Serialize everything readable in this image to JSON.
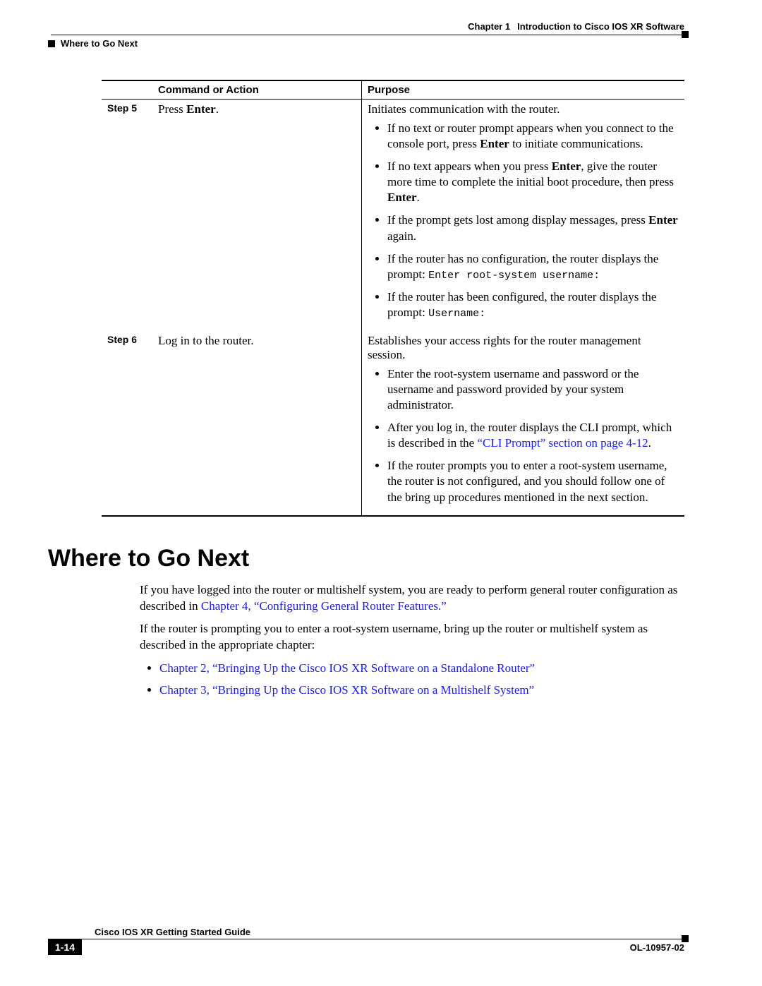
{
  "header": {
    "chapter_label": "Chapter 1",
    "chapter_title": "Introduction to Cisco IOS XR Software",
    "section": "Where to Go Next"
  },
  "table": {
    "col1": "Command or Action",
    "col2": "Purpose",
    "rows": [
      {
        "step": "Step 5",
        "command_pre": "Press ",
        "command_bold": "Enter",
        "command_post": ".",
        "purpose_lead": "Initiates communication with the router.",
        "bullets": [
          {
            "pre": "If no text or router prompt appears when you connect to the console port, press ",
            "b": "Enter",
            "post": " to initiate communications."
          },
          {
            "pre": "If no text appears when you press ",
            "b": "Enter",
            "post": ", give the router more time to complete the initial boot procedure, then press ",
            "b2": "Enter",
            "post2": "."
          },
          {
            "pre": "If the prompt gets lost among display messages, press ",
            "b": "Enter",
            "post": " again."
          },
          {
            "pre": "If the router has no configuration, the router displays the prompt: ",
            "mono": "Enter root-system username:"
          },
          {
            "pre": "If the router has been configured, the router displays the prompt: ",
            "mono": "Username:"
          }
        ]
      },
      {
        "step": "Step 6",
        "command_plain": "Log in to the router.",
        "purpose_lead": "Establishes your access rights for the router management session.",
        "bullets": [
          {
            "pre": "Enter the root-system username and password or the username and password provided by your system administrator."
          },
          {
            "pre": "After you log in, the router displays the CLI prompt, which is described in the ",
            "link": "“CLI Prompt” section on page 4-12",
            "post": "."
          },
          {
            "pre": "If the router prompts you to enter a root-system username, the router is not configured, and you should follow one of the bring up procedures mentioned in the next section."
          }
        ]
      }
    ]
  },
  "section_heading": "Where to Go Next",
  "body": {
    "p1_pre": "If you have logged into the router or multishelf system, you are ready to perform general router configuration as described in ",
    "p1_link": "Chapter 4, “Configuring General Router Features.”",
    "p2": "If the router is prompting you to enter a root-system username, bring up the router or multishelf system as described in the appropriate chapter:",
    "links": [
      "Chapter 2, “Bringing Up the Cisco IOS XR Software on a Standalone Router”",
      "Chapter 3, “Bringing Up the Cisco IOS XR Software on a Multishelf System”"
    ]
  },
  "footer": {
    "book": "Cisco IOS XR Getting Started Guide",
    "page": "1-14",
    "docnum": "OL-10957-02"
  }
}
